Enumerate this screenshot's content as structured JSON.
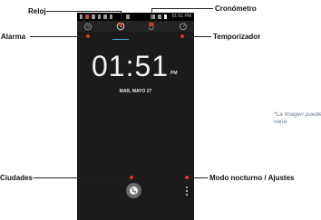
{
  "callouts": {
    "clock": "Reloj",
    "stopwatch": "Cronómetro",
    "alarm": "Alarma",
    "timer": "Temporizador",
    "cities": "Ciudades",
    "night_settings": "Modo nocturno / Ajustes"
  },
  "note": "*La imagen puede varia",
  "phone": {
    "status_time": "01:51",
    "status_ampm": "PM",
    "clock_time": "01:51",
    "clock_ampm": "PM",
    "date": "MAR, MAYO 27"
  },
  "colors": {
    "marker": "#e8311d",
    "accent": "#33b5e5",
    "screen_bg": "#1b1b1b"
  },
  "icons": [
    "alarm-icon",
    "clock-icon",
    "stopwatch-icon",
    "timer-icon",
    "globe-icon",
    "overflow-menu-icon"
  ]
}
